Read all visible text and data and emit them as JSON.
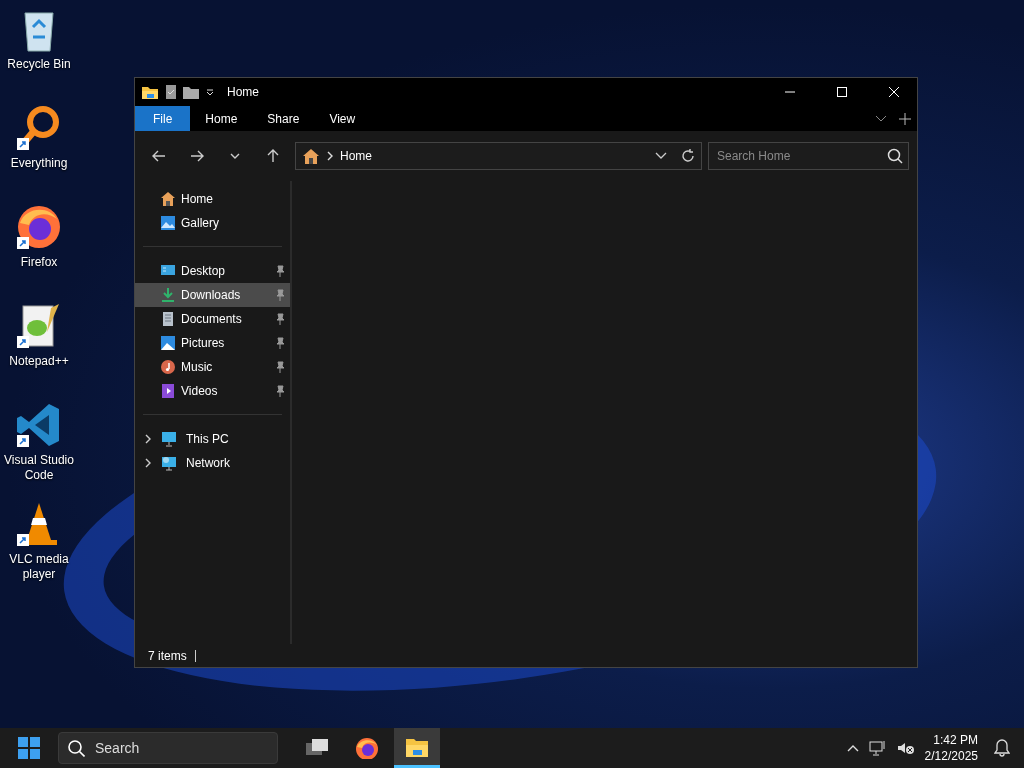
{
  "desktop_icons": [
    {
      "label": "Recycle Bin",
      "kind": "recycle",
      "shortcut": false
    },
    {
      "label": "Everything",
      "kind": "everything",
      "shortcut": true
    },
    {
      "label": "Firefox",
      "kind": "firefox",
      "shortcut": true
    },
    {
      "label": "Notepad++",
      "kind": "notepad",
      "shortcut": true
    },
    {
      "label": "Visual Studio Code",
      "kind": "vscode",
      "shortcut": true
    },
    {
      "label": "VLC media player",
      "kind": "vlc",
      "shortcut": true
    }
  ],
  "window": {
    "title": "Home",
    "ribbon_tabs": [
      {
        "label": "File",
        "selected": true
      },
      {
        "label": "Home",
        "selected": false
      },
      {
        "label": "Share",
        "selected": false
      },
      {
        "label": "View",
        "selected": false
      }
    ],
    "address": {
      "location": "Home"
    },
    "search": {
      "placeholder": "Search Home"
    },
    "sidebar": {
      "groups": [
        [
          {
            "label": "Home",
            "kind": "home",
            "pinned": false,
            "selected": false,
            "expandable": false
          },
          {
            "label": "Gallery",
            "kind": "gallery",
            "pinned": false,
            "selected": false,
            "expandable": false
          }
        ],
        [
          {
            "label": "Desktop",
            "kind": "desktop",
            "pinned": true,
            "selected": false,
            "expandable": false
          },
          {
            "label": "Downloads",
            "kind": "downloads",
            "pinned": true,
            "selected": true,
            "expandable": false
          },
          {
            "label": "Documents",
            "kind": "documents",
            "pinned": true,
            "selected": false,
            "expandable": false
          },
          {
            "label": "Pictures",
            "kind": "pictures",
            "pinned": true,
            "selected": false,
            "expandable": false
          },
          {
            "label": "Music",
            "kind": "music",
            "pinned": true,
            "selected": false,
            "expandable": false
          },
          {
            "label": "Videos",
            "kind": "videos",
            "pinned": true,
            "selected": false,
            "expandable": false
          }
        ],
        [
          {
            "label": "This PC",
            "kind": "pc",
            "pinned": false,
            "selected": false,
            "expandable": true
          },
          {
            "label": "Network",
            "kind": "network",
            "pinned": false,
            "selected": false,
            "expandable": true
          }
        ]
      ]
    },
    "status_bar": {
      "item_count": "7 items"
    }
  },
  "taskbar": {
    "search_placeholder": "Search",
    "apps": [
      {
        "kind": "taskview",
        "active": false
      },
      {
        "kind": "firefox",
        "active": false
      },
      {
        "kind": "explorer",
        "active": true
      }
    ],
    "time": "1:42 PM",
    "date": "2/12/2025"
  }
}
